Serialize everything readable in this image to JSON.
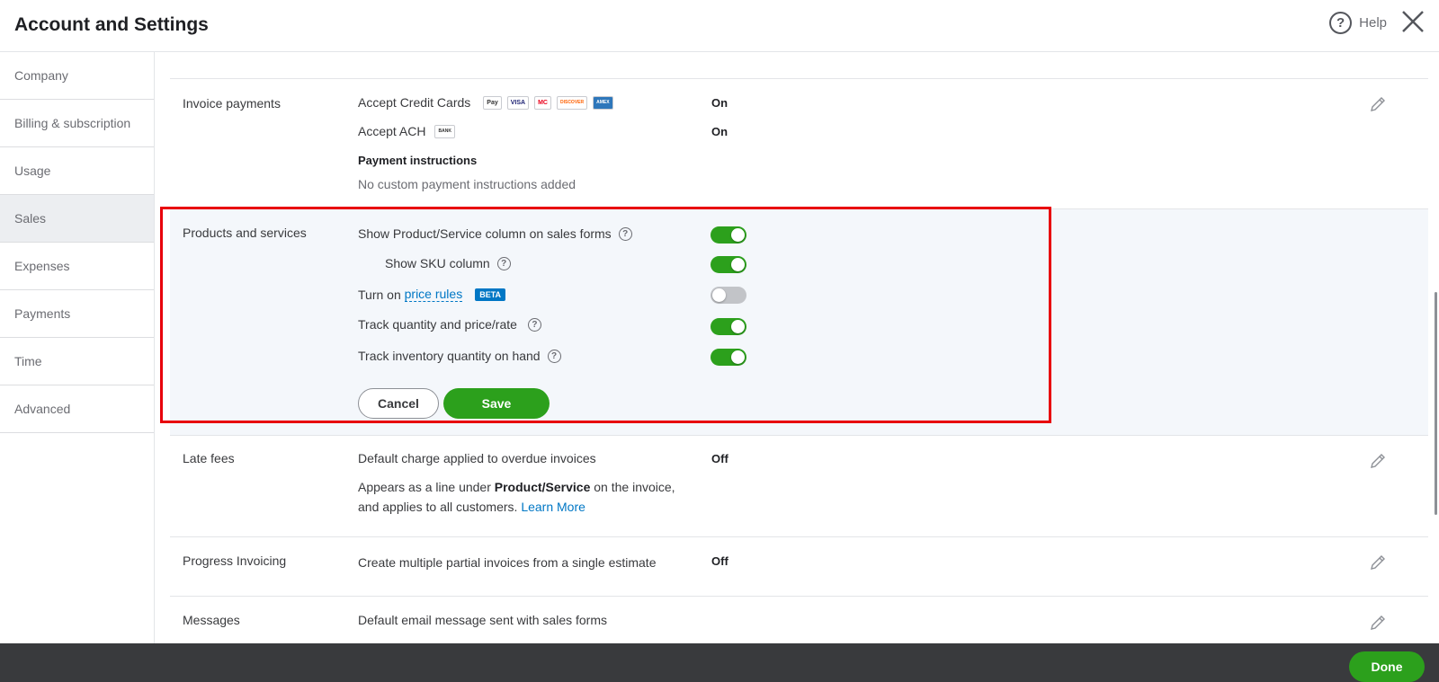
{
  "header": {
    "title": "Account and Settings",
    "help_label": "Help"
  },
  "sidebar": {
    "items": [
      {
        "label": "Company"
      },
      {
        "label": "Billing & subscription"
      },
      {
        "label": "Usage"
      },
      {
        "label": "Sales"
      },
      {
        "label": "Expenses"
      },
      {
        "label": "Payments"
      },
      {
        "label": "Time"
      },
      {
        "label": "Advanced"
      }
    ]
  },
  "invoice_payments": {
    "label": "Invoice payments",
    "accept_cc": "Accept Credit Cards",
    "cc_value": "On",
    "card_logos": [
      "Pay",
      "VISA",
      "MC",
      "DISCOVER",
      "AMEX"
    ],
    "accept_ach": "Accept ACH",
    "ach_badge": "BANK",
    "ach_value": "On",
    "instructions_title": "Payment instructions",
    "instructions_text": "No custom payment instructions added"
  },
  "products": {
    "label": "Products and services",
    "show_ps_column": "Show Product/Service column on sales forms",
    "show_sku": "Show SKU column",
    "price_rules_prefix": "Turn on",
    "price_rules_link": "price rules",
    "beta": "BETA",
    "track_qty": "Track quantity and price/rate",
    "track_inventory": "Track inventory quantity on hand",
    "cancel": "Cancel",
    "save": "Save"
  },
  "late_fees": {
    "label": "Late fees",
    "text1": "Default charge applied to overdue invoices",
    "value": "Off",
    "text2_prefix": "Appears as a line under",
    "text2_bold": "Product/Service",
    "text2_suffix": "on the invoice,",
    "text3": "and applies to all customers.",
    "learn_more": "Learn More"
  },
  "progress": {
    "label": "Progress Invoicing",
    "text": "Create multiple partial invoices from a single estimate",
    "value": "Off"
  },
  "messages": {
    "label": "Messages",
    "text": "Default email message sent with sales forms"
  },
  "footer": {
    "done": "Done"
  }
}
